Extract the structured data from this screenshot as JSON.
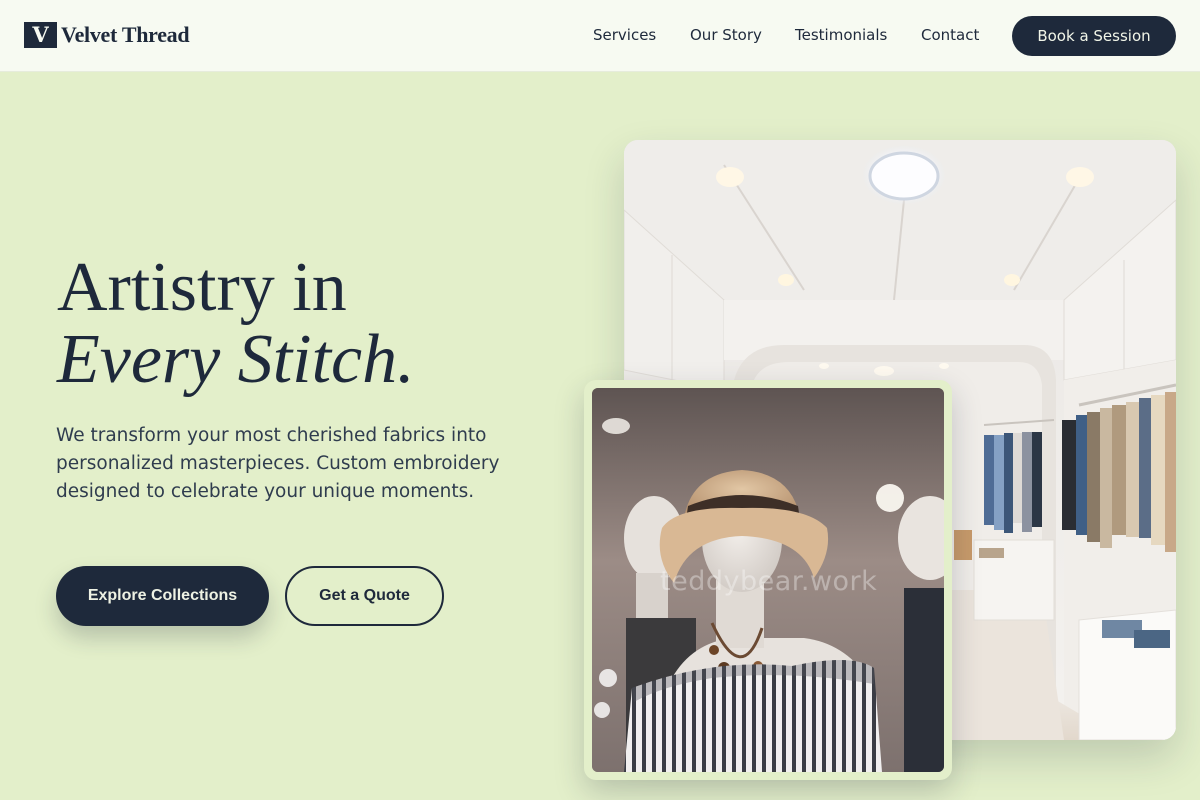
{
  "brand": {
    "mark": "V",
    "name": "Velvet Thread"
  },
  "nav": {
    "items": [
      {
        "label": "Services"
      },
      {
        "label": "Our Story"
      },
      {
        "label": "Testimonials"
      },
      {
        "label": "Contact"
      }
    ],
    "cta_label": "Book a Session"
  },
  "hero": {
    "headline_line1": "Artistry in",
    "headline_line2": "Every Stitch.",
    "subtext": "We transform your most cherished fabrics into personalized masterpieces. Custom embroidery designed to celebrate your unique moments.",
    "primary_button": "Explore Collections",
    "secondary_button": "Get a Quote"
  },
  "images": {
    "watermark": "teddybear.work"
  },
  "colors": {
    "background": "#e3efca",
    "header_bg": "#f7faf2",
    "navy": "#1e293b"
  }
}
